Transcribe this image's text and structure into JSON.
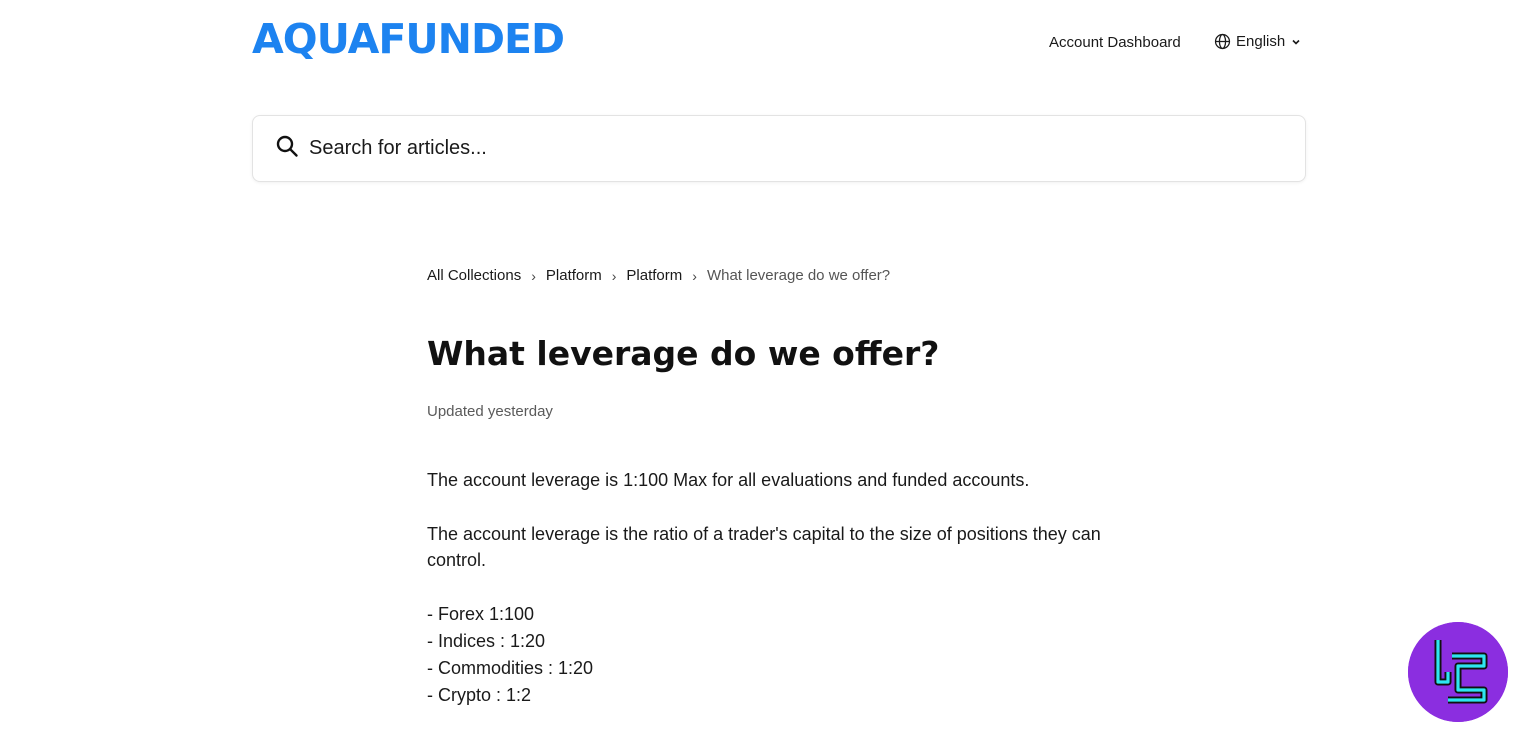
{
  "header": {
    "logo_text": "AQUAFUNDED",
    "account_dashboard": "Account Dashboard",
    "language": "English"
  },
  "search": {
    "placeholder": "Search for articles..."
  },
  "breadcrumb": {
    "items": [
      "All Collections",
      "Platform",
      "Platform"
    ],
    "current": "What leverage do we offer?"
  },
  "article": {
    "title": "What leverage do we offer?",
    "updated": "Updated yesterday",
    "paragraph1": "The account leverage is 1:100 Max for all evaluations and funded accounts.",
    "paragraph2": "The account leverage is the ratio of a trader's capital to the size of positions they can control.",
    "list": [
      "- Forex 1:100",
      "- Indices : 1:20",
      "- Commodities : 1:20",
      "- Crypto : 1:2"
    ]
  },
  "colors": {
    "brand": "#1d83f0",
    "badge": "#8b2ee0",
    "badge_accent": "#2ee6f0"
  },
  "icons": {
    "search": "search-icon",
    "language": "globe-icon",
    "dropdown": "chevron-down-icon",
    "badge": "tradingfinder-logo-icon"
  }
}
